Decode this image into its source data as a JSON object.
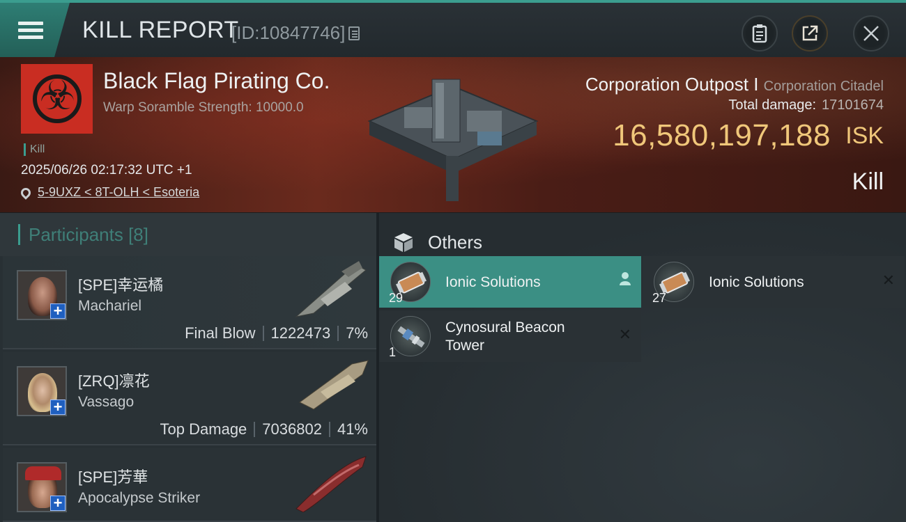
{
  "header": {
    "title": "KILL REPORT",
    "report_id": "[ID:10847746]"
  },
  "banner": {
    "corp_name": "Black Flag Pirating Co.",
    "warp_strength": "Warp Soramble Strength: 10000.0",
    "kill_tag": "Kill",
    "timestamp": "2025/06/26 02:17:32 UTC +1",
    "location": "5-9UXZ < 8T-OLH < Esoteria",
    "ship_type": "Corporation Outpost I",
    "ship_class": "Corporation Citadel",
    "total_damage_label": "Total damage:",
    "total_damage_value": "17101674",
    "isk_value": "16,580,197,188",
    "isk_unit": "ISK",
    "result_label": "Kill"
  },
  "participants": {
    "header_label": "Participants [8]",
    "items": [
      {
        "name": "[SPE]幸运橘",
        "ship": "Machariel",
        "role": "Final Blow",
        "damage": "1222473",
        "percent": "7%"
      },
      {
        "name": "[ZRQ]凛花",
        "ship": "Vassago",
        "role": "Top Damage",
        "damage": "7036802",
        "percent": "41%"
      },
      {
        "name": "[SPE]芳華",
        "ship": "Apocalypse Striker",
        "role": "",
        "damage": "",
        "percent": ""
      }
    ]
  },
  "others": {
    "header_label": "Others",
    "items": [
      {
        "name": "Ionic Solutions",
        "qty": "29",
        "mark": "person-icon"
      },
      {
        "name": "Ionic Solutions",
        "qty": "27",
        "mark": "close-icon"
      },
      {
        "name_line1": "Cynosural Beacon",
        "name_line2": "Tower",
        "qty": "1",
        "mark": "close-icon"
      }
    ]
  },
  "colors": {
    "accent": "#3b9d8f",
    "isk_gold": "#f0c77a",
    "corp_red": "#c92d22"
  }
}
